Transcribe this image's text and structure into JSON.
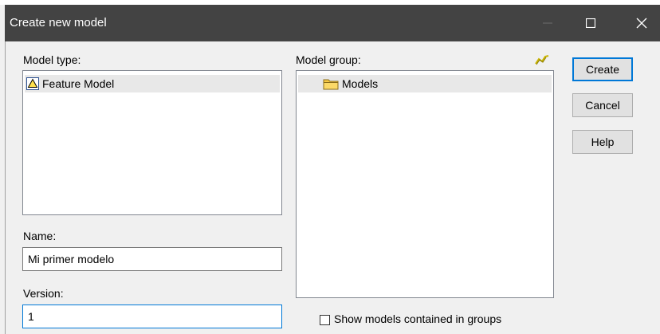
{
  "window": {
    "title": "Create new model"
  },
  "model_type": {
    "label": "Model type:",
    "items": [
      {
        "label": "Feature Model",
        "icon": "feature-model-icon",
        "selected": true
      }
    ]
  },
  "model_group": {
    "label": "Model group:",
    "items": [
      {
        "label": "Models",
        "icon": "folder-icon",
        "selected": true
      }
    ],
    "action_icon": "pin-icon"
  },
  "name": {
    "label": "Name:",
    "value": "Mi primer modelo"
  },
  "version": {
    "label": "Version:",
    "value": "1"
  },
  "buttons": {
    "create": "Create",
    "cancel": "Cancel",
    "help": "Help"
  },
  "show_models": {
    "label": "Show models contained in groups",
    "checked": false
  },
  "colors": {
    "titlebar": "#434343",
    "accent": "#0078d7",
    "selection": "#e8e8e8",
    "dialog_bg": "#f0f0f0",
    "folder": "#f5c842"
  }
}
